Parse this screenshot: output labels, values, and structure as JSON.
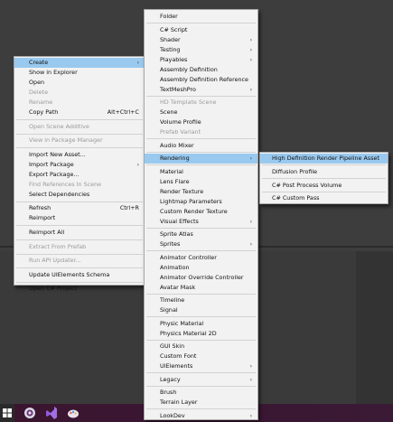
{
  "main_menu": [
    {
      "label": "Create",
      "highlighted": true,
      "submenu": true
    },
    {
      "label": "Show in Explorer"
    },
    {
      "label": "Open"
    },
    {
      "label": "Delete",
      "disabled": true
    },
    {
      "label": "Rename",
      "disabled": true
    },
    {
      "label": "Copy Path",
      "shortcut": "Alt+Ctrl+C"
    },
    {
      "sep": true
    },
    {
      "label": "Open Scene Additive",
      "disabled": true
    },
    {
      "sep": true
    },
    {
      "label": "View in Package Manager",
      "disabled": true
    },
    {
      "sep": true
    },
    {
      "label": "Import New Asset..."
    },
    {
      "label": "Import Package",
      "submenu": true
    },
    {
      "label": "Export Package..."
    },
    {
      "label": "Find References In Scene",
      "disabled": true
    },
    {
      "label": "Select Dependencies"
    },
    {
      "sep": true
    },
    {
      "label": "Refresh",
      "shortcut": "Ctrl+R"
    },
    {
      "label": "Reimport"
    },
    {
      "sep": true
    },
    {
      "label": "Reimport All"
    },
    {
      "sep": true
    },
    {
      "label": "Extract From Prefab",
      "disabled": true
    },
    {
      "sep": true
    },
    {
      "label": "Run API Updater...",
      "disabled": true
    },
    {
      "sep": true
    },
    {
      "label": "Update UIElements Schema"
    },
    {
      "sep": true
    },
    {
      "label": "Open C# Project"
    }
  ],
  "create_menu": [
    {
      "label": "Folder"
    },
    {
      "sep": true
    },
    {
      "label": "C# Script"
    },
    {
      "label": "Shader",
      "submenu": true
    },
    {
      "label": "Testing",
      "submenu": true
    },
    {
      "label": "Playables",
      "submenu": true
    },
    {
      "label": "Assembly Definition"
    },
    {
      "label": "Assembly Definition Reference"
    },
    {
      "label": "TextMeshPro",
      "submenu": true
    },
    {
      "sep": true
    },
    {
      "label": "HD Template Scene",
      "disabled": true
    },
    {
      "label": "Scene"
    },
    {
      "label": "Volume Profile"
    },
    {
      "label": "Prefab Variant",
      "disabled": true
    },
    {
      "sep": true
    },
    {
      "label": "Audio Mixer"
    },
    {
      "sep": true
    },
    {
      "label": "Rendering",
      "highlighted": true,
      "submenu": true
    },
    {
      "sep": true
    },
    {
      "label": "Material"
    },
    {
      "label": "Lens Flare"
    },
    {
      "label": "Render Texture"
    },
    {
      "label": "Lightmap Parameters"
    },
    {
      "label": "Custom Render Texture"
    },
    {
      "label": "Visual Effects",
      "submenu": true
    },
    {
      "sep": true
    },
    {
      "label": "Sprite Atlas"
    },
    {
      "label": "Sprites",
      "submenu": true
    },
    {
      "sep": true
    },
    {
      "label": "Animator Controller"
    },
    {
      "label": "Animation"
    },
    {
      "label": "Animator Override Controller"
    },
    {
      "label": "Avatar Mask"
    },
    {
      "sep": true
    },
    {
      "label": "Timeline"
    },
    {
      "label": "Signal"
    },
    {
      "sep": true
    },
    {
      "label": "Physic Material"
    },
    {
      "label": "Physics Material 2D"
    },
    {
      "sep": true
    },
    {
      "label": "GUI Skin"
    },
    {
      "label": "Custom Font"
    },
    {
      "label": "UIElements",
      "submenu": true
    },
    {
      "sep": true
    },
    {
      "label": "Legacy",
      "submenu": true
    },
    {
      "sep": true
    },
    {
      "label": "Brush"
    },
    {
      "label": "Terrain Layer"
    },
    {
      "sep": true
    },
    {
      "label": "LookDev",
      "submenu": true
    }
  ],
  "rendering_menu": [
    {
      "label": "High Definition Render Pipeline Asset",
      "highlighted": true
    },
    {
      "sep": true
    },
    {
      "label": "Diffusion Profile"
    },
    {
      "sep": true
    },
    {
      "label": "C# Post Process Volume"
    },
    {
      "sep": true
    },
    {
      "label": "C# Custom Pass"
    }
  ],
  "colors": {
    "menu_bg": "#f2f2f2",
    "highlight": "#99c9ef",
    "disabled_text": "#9a9a9a",
    "taskbar": "#3b1530"
  },
  "taskbar": {
    "icons": [
      "windows-start-icon",
      "unity-hub-icon",
      "visual-studio-icon",
      "paint-app-icon"
    ]
  }
}
